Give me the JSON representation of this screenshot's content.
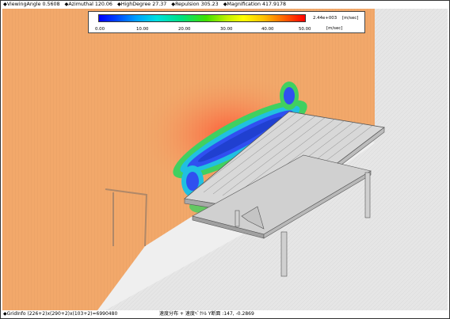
{
  "status_bar": {
    "items": [
      "◆ViewingAngle  0.5608",
      "◆Azimuthal 120.06",
      "◆HighDegree 27.37",
      "◆Repulsion 305.23",
      "◆Magnification 417.9178"
    ]
  },
  "legend": {
    "ticks": [
      "0.00",
      "10.00",
      "20.00",
      "30.00",
      "40.00",
      "50.00"
    ],
    "max_value": "2.44e+003",
    "unit_top": "[m/sec]",
    "unit_bottom": "[m/sec]",
    "colors": [
      "#0000ff",
      "#00a0ff",
      "#00e080",
      "#ffff00",
      "#ff6000",
      "#ff0000"
    ]
  },
  "footer": {
    "grid_info": "◆GridInfo  (226+2)x(290+2)x(103+2)=6990480",
    "section_info": "速度分布 + 速度ﾍﾞｸﾄﾙ Y断面 :147,  -0.2869"
  },
  "scene": {
    "field_color": "#f0a868",
    "floor_color": "#e8e8e8",
    "structure_color": "#c8c8c8"
  }
}
